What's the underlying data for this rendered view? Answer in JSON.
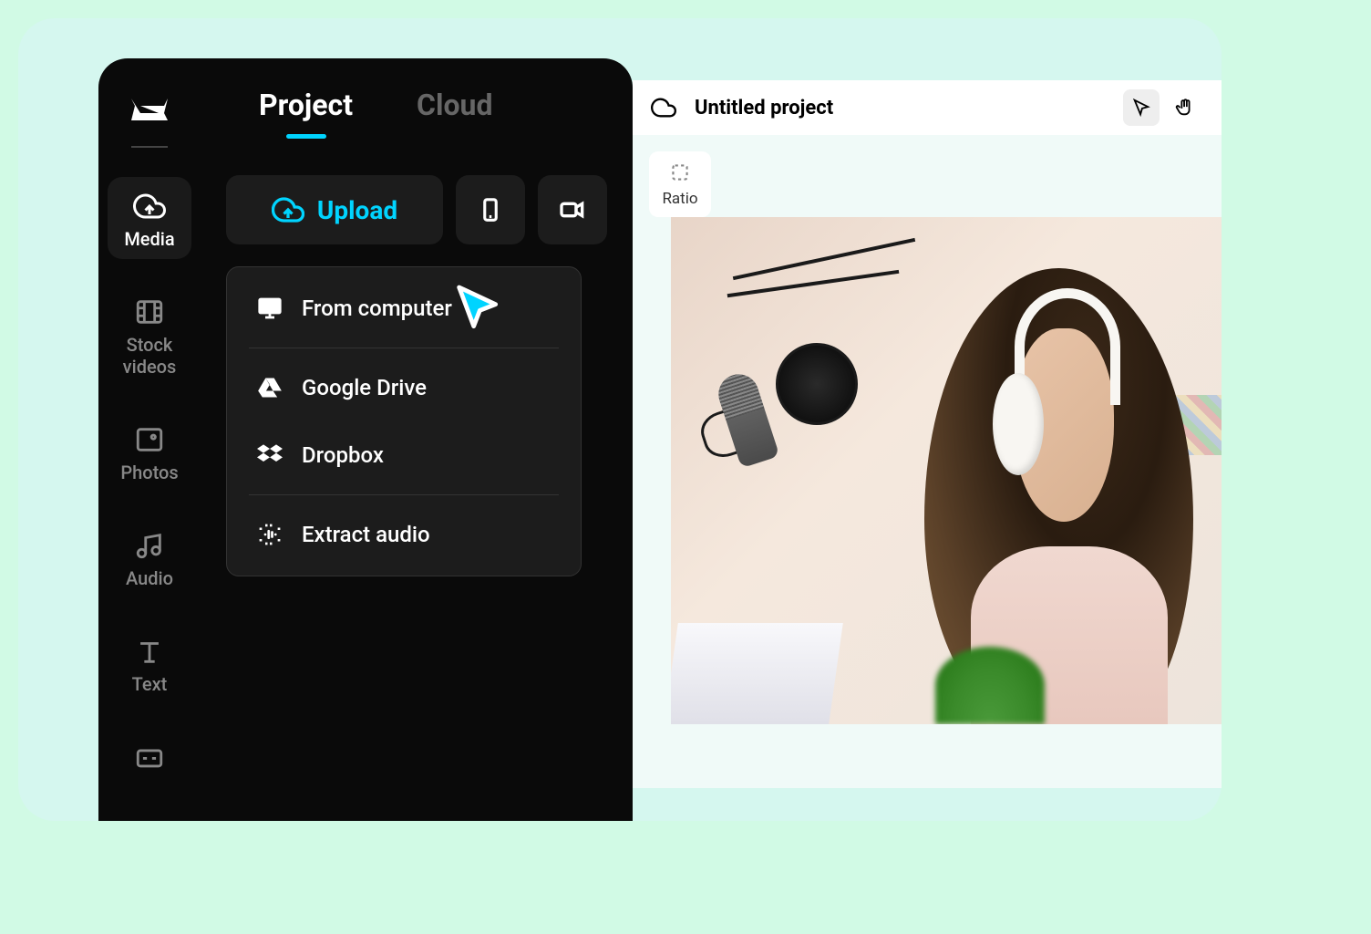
{
  "sidebar": {
    "items": [
      {
        "label": "Media"
      },
      {
        "label": "Stock videos"
      },
      {
        "label": "Photos"
      },
      {
        "label": "Audio"
      },
      {
        "label": "Text"
      }
    ]
  },
  "tabs": {
    "project": "Project",
    "cloud": "Cloud"
  },
  "upload": {
    "label": "Upload"
  },
  "uploadMenu": {
    "fromComputer": "From computer",
    "googleDrive": "Google Drive",
    "dropbox": "Dropbox",
    "extractAudio": "Extract audio"
  },
  "editor": {
    "title": "Untitled project",
    "ratio": "Ratio"
  }
}
